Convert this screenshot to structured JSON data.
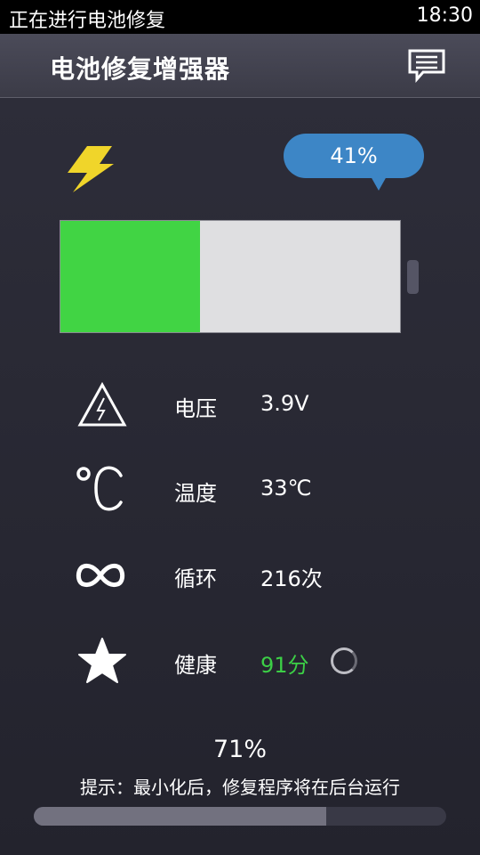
{
  "statusbar": {
    "notification": "正在进行电池修复",
    "time": "18:30"
  },
  "appbar": {
    "title": "电池修复增强器",
    "message_icon": "message-icon"
  },
  "battery": {
    "charge_label": "41%",
    "charge_fraction": 0.41,
    "fill_color": "#41d444",
    "charging_icon": "lightning-bolt-icon"
  },
  "stats": [
    {
      "icon": "high-voltage-warning-icon",
      "label": "电压",
      "value": "3.9V"
    },
    {
      "icon": "celsius-icon",
      "label": "温度",
      "value": "33℃"
    },
    {
      "icon": "infinity-icon",
      "label": "循环",
      "value": "216次"
    },
    {
      "icon": "star-icon",
      "label": "健康",
      "value": "91分",
      "value_color": "#3ccf46"
    }
  ],
  "repair": {
    "progress_label": "71%",
    "progress_fraction": 0.71,
    "tip": "提示：最小化后，修复程序将在后台运行"
  },
  "colors": {
    "accent_blue": "#3d86c6",
    "health_green": "#3ccf46",
    "bolt_yellow": "#f0d52a"
  }
}
